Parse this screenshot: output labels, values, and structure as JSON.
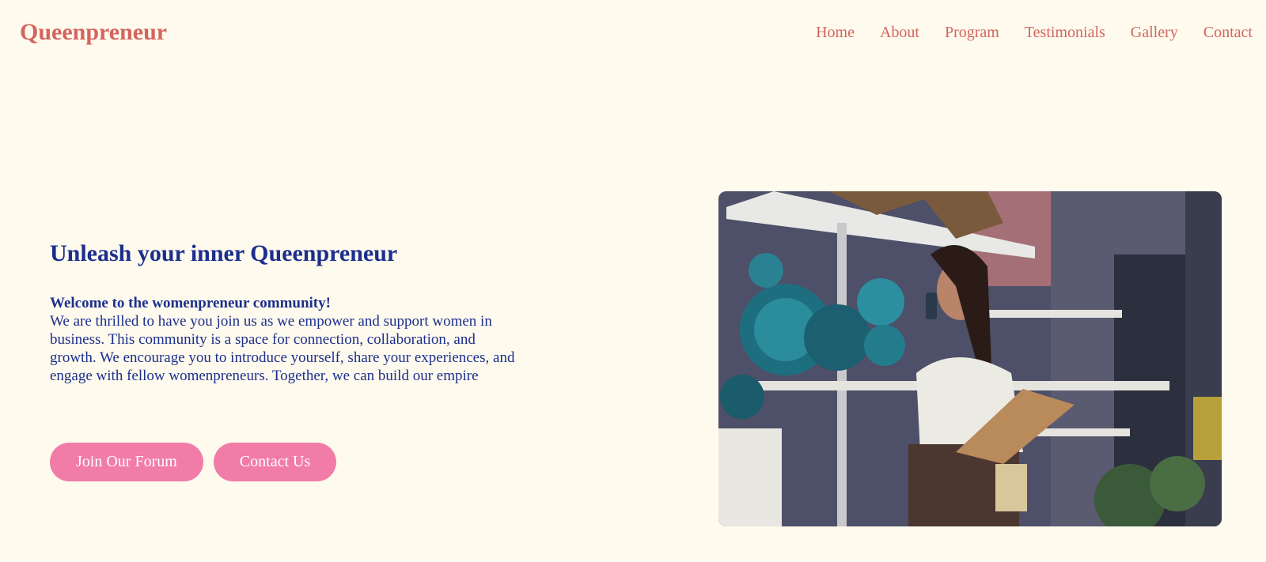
{
  "brand": {
    "name": "Queenpreneur"
  },
  "nav": {
    "items": [
      {
        "label": "Home"
      },
      {
        "label": "About"
      },
      {
        "label": "Program"
      },
      {
        "label": "Testimonials"
      },
      {
        "label": "Gallery"
      },
      {
        "label": "Contact"
      }
    ]
  },
  "hero": {
    "title": "Unleash your inner Queenpreneur",
    "welcome": "Welcome to the womenpreneur community!",
    "body": "We are thrilled to have you join us as we empower and support women in business. This community is a space for connection, collaboration, and growth. We encourage you to introduce yourself, share your experiences, and engage with fellow womenpreneurs. Together, we can build our empire",
    "buttons": {
      "forum": "Join Our Forum",
      "contact": "Contact Us"
    }
  },
  "colors": {
    "background": "#fffaee",
    "accent": "#d4655e",
    "heading": "#1c2f8c",
    "button": "#f17ca7",
    "button_text": "#ffffff"
  }
}
